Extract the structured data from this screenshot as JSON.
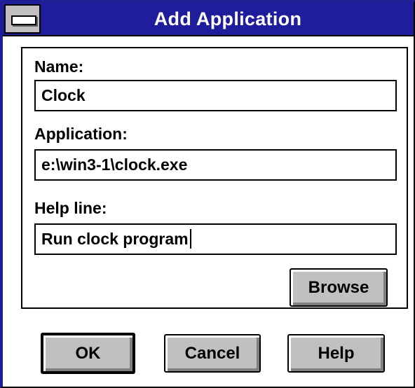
{
  "window": {
    "title": "Add Application",
    "system_menu_icon": "system-menu-icon"
  },
  "form": {
    "name_label": "Name:",
    "name_value": "Clock",
    "application_label": "Application:",
    "application_value": "e:\\win3-1\\clock.exe",
    "helpline_label": "Help line:",
    "helpline_value": "Run clock program"
  },
  "buttons": {
    "browse": "Browse",
    "ok": "OK",
    "cancel": "Cancel",
    "help": "Help"
  },
  "colors": {
    "titlebar": "#1e1e9c",
    "button_face": "#c0c0c0"
  }
}
